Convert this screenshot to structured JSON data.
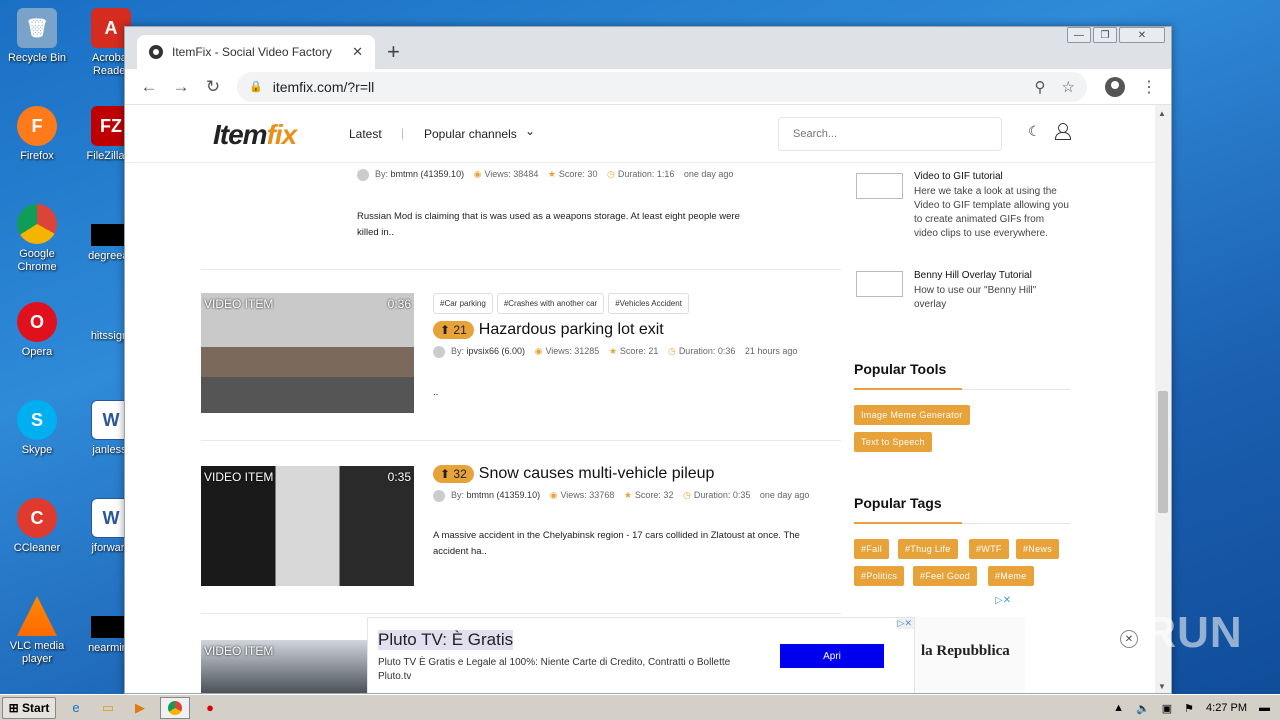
{
  "desktop": {
    "icons": [
      {
        "label": "Recycle Bin"
      },
      {
        "label": "Acrobat Reader"
      },
      {
        "label": "Firefox"
      },
      {
        "label": "FileZilla C"
      },
      {
        "label": "Google Chrome"
      },
      {
        "label": "degreeac"
      },
      {
        "label": "Opera"
      },
      {
        "label": "hitssign."
      },
      {
        "label": "Skype"
      },
      {
        "label": "janless."
      },
      {
        "label": "CCleaner"
      },
      {
        "label": "jforward"
      },
      {
        "label": "VLC media player"
      },
      {
        "label": "nearminu"
      }
    ]
  },
  "browser": {
    "tab_title": "ItemFix - Social Video Factory",
    "tab_close": "✕",
    "new_tab": "+",
    "url": "itemfix.com/?r=ll",
    "win_min": "—",
    "win_max": "❐",
    "win_close": "✕"
  },
  "site": {
    "logo_main": "Item",
    "logo_accent": "fix",
    "nav_latest": "Latest",
    "nav_popular": "Popular channels",
    "search_placeholder": "Search...",
    "accent_color": "#e8a23a"
  },
  "videos": [
    {
      "score": "",
      "title": "",
      "author": "bmtmn (41359.10)",
      "views": "Views: 38484",
      "score_text": "Score: 30",
      "duration": "Duration: 1:16",
      "ago": "one day ago",
      "description": "Russian Mod is claiming that is was used as a weapons storage. At least eight people were killed in.."
    },
    {
      "label": "VIDEO ITEM",
      "time": "0:36",
      "tags": [
        "#Car parking",
        "#Crashes with another car",
        "#Vehicles Accident"
      ],
      "score": "21",
      "title": "Hazardous parking lot exit",
      "author": "ipvsix66 (6.00)",
      "views": "Views: 31285",
      "score_text": "Score: 21",
      "duration": "Duration: 0:36",
      "ago": "21 hours ago",
      "description": ".."
    },
    {
      "label": "VIDEO ITEM",
      "time": "0:35",
      "score": "32",
      "title": "Snow causes multi-vehicle pileup",
      "author": "bmtmn (41359.10)",
      "views": "Views: 33768",
      "score_text": "Score: 32",
      "duration": "Duration: 0:35",
      "ago": "one day ago",
      "description": "A massive accident in the Chelyabinsk region - 17 cars collided in Zlatoust at once. The accident ha.."
    },
    {
      "label": "VIDEO ITEM"
    }
  ],
  "by_label": "By:",
  "sidebar": {
    "tutorials": [
      {
        "title": "Video to GIF tutorial",
        "desc": "Here we take a look at using the Video to GIF template allowing you to create animated GIFs from video clips to use everywhere."
      },
      {
        "title": "Benny Hill Overlay Tutorial",
        "desc": "How to use our \"Benny Hill\" overlay"
      }
    ],
    "tools_heading": "Popular Tools",
    "tools": [
      "Image Meme Generator",
      "Text to Speech"
    ],
    "tags_heading": "Popular Tags",
    "tags": [
      "#Fail",
      "#Thug Life",
      "#WTF",
      "#News",
      "#Politics",
      "#Feel Good",
      "#Meme"
    ]
  },
  "ad": {
    "title": "Pluto TV: È Gratis",
    "text": "Pluto TV È Gratis e Legale al 100%: Niente Carte di Credito, Contratti o Bollette Pluto.tv",
    "button": "Apri",
    "brand": "la Repubblica"
  },
  "watermark": "ANY RUN",
  "taskbar": {
    "start": "Start",
    "clock": "4:27 PM"
  }
}
